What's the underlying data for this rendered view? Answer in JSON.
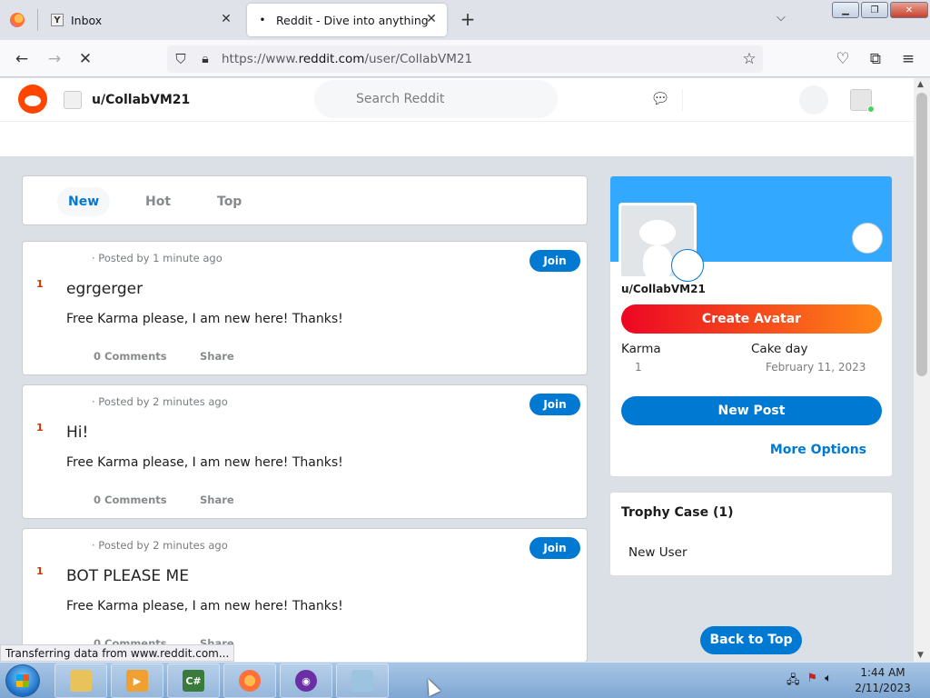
{
  "browser": {
    "tabs": [
      {
        "label": "Inbox",
        "favicon": "Y"
      },
      {
        "label": "Reddit - Dive into anything",
        "favicon": "•"
      }
    ],
    "url_prefix": "https://www.",
    "url_domain": "reddit.com",
    "url_path": "/user/CollabVM21",
    "status_text": "Transferring data from www.reddit.com..."
  },
  "reddit_header": {
    "username": "u/CollabVM21",
    "search_placeholder": "Search Reddit"
  },
  "feed": {
    "sort_tabs": [
      "New",
      "Hot",
      "Top"
    ],
    "active_sort": "New",
    "posts": [
      {
        "votes": "1",
        "meta": "· Posted by 1 minute ago",
        "join": "Join",
        "title": "egrgerger",
        "body": "Free Karma please, I am new here! Thanks!",
        "comments": "0 Comments",
        "share": "Share"
      },
      {
        "votes": "1",
        "meta": "· Posted by 2 minutes ago",
        "join": "Join",
        "title": "Hi!",
        "body": "Free Karma please, I am new here! Thanks!",
        "comments": "0 Comments",
        "share": "Share"
      },
      {
        "votes": "1",
        "meta": "· Posted by 2 minutes ago",
        "join": "Join",
        "title": "BOT PLEASE ME",
        "body": "Free Karma please, I am new here! Thanks!",
        "comments": "0 Comments",
        "share": "Share"
      }
    ]
  },
  "profile": {
    "handle": "u/CollabVM21",
    "create_avatar": "Create Avatar",
    "karma_label": "Karma",
    "karma_value": "1",
    "cake_day_label": "Cake day",
    "cake_day_value": "February 11, 2023",
    "new_post": "New Post",
    "more_options": "More Options"
  },
  "trophy_case": {
    "title": "Trophy Case (1)",
    "items": [
      "New User"
    ]
  },
  "back_to_top": "Back to Top",
  "taskbar": {
    "time": "1:44 AM",
    "date": "2/11/2023"
  },
  "colors": {
    "reddit_orange": "#ff4500",
    "reddit_blue": "#0079d3",
    "banner_blue": "#33a8ff"
  }
}
